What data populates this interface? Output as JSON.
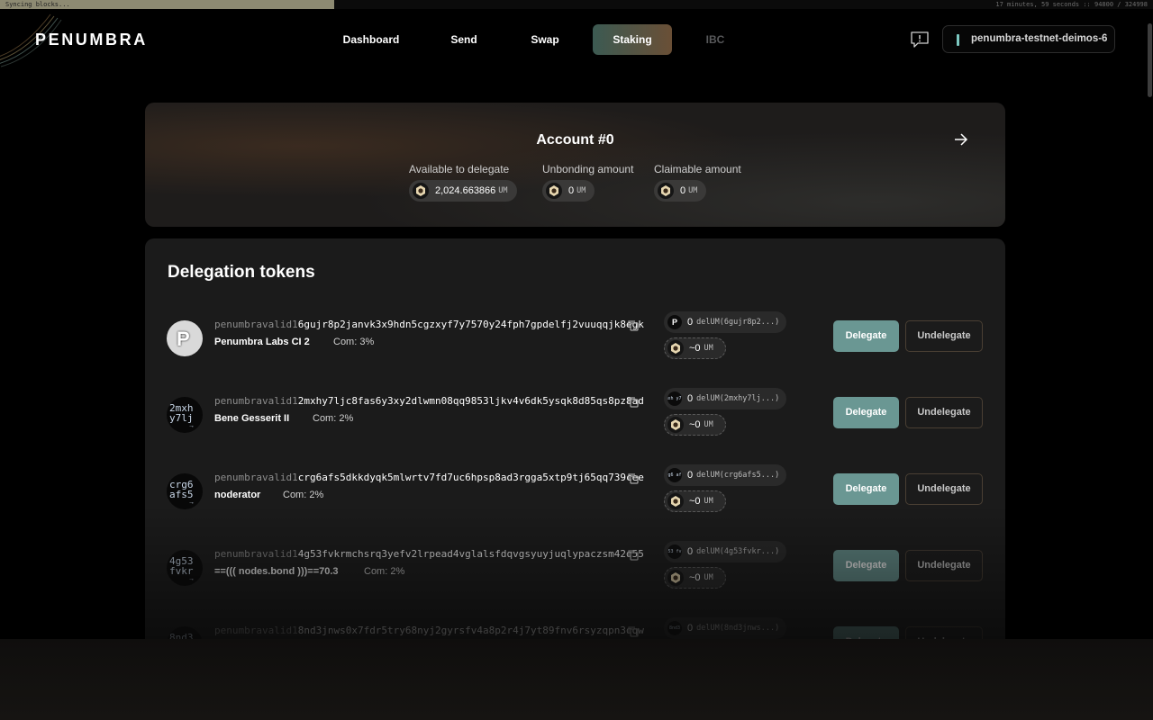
{
  "sync": {
    "status": "Syncing blocks...",
    "time_remaining": "17 minutes, 59 seconds",
    "block_count": "94800 / 324998",
    "progress": 0.29
  },
  "header": {
    "logo": "PENUMBRA",
    "nav": [
      {
        "label": "Dashboard",
        "state": "normal"
      },
      {
        "label": "Send",
        "state": "normal"
      },
      {
        "label": "Swap",
        "state": "normal"
      },
      {
        "label": "Staking",
        "state": "active"
      },
      {
        "label": "IBC",
        "state": "disabled"
      }
    ],
    "feedback_icon": "feedback-icon",
    "chain_id": "penumbra-testnet-deimos-6"
  },
  "account": {
    "title": "Account #0",
    "available": {
      "label": "Available to delegate",
      "amount": "2,024.663866",
      "symbol": "UM"
    },
    "unbonding": {
      "label": "Unbonding amount",
      "amount": "0",
      "symbol": "UM"
    },
    "claimable": {
      "label": "Claimable amount",
      "amount": "0",
      "symbol": "UM"
    }
  },
  "delegation": {
    "title": "Delegation tokens",
    "delegate_label": "Delegate",
    "undelegate_label": "Undelegate",
    "validators": [
      {
        "prefix": "penumbravalid1",
        "id": "6gujr8p2janvk3x9hdn5cgzxyf7y7570y24fph7gpdelfj2vuuqqjk8egk",
        "name": "Penumbra Labs CI 2",
        "commission": "Com: 3%",
        "avatar": "P",
        "delegation_amount": "0",
        "delegation_token": "delUM(6gujr8p2...)",
        "unbonding_amount": "~0",
        "unbonding_token": "UM"
      },
      {
        "prefix": "penumbravalid1",
        "id": "2mxhy7ljc8fas6y3xy2dlwmn08qq9853ljkv4v6dk5ysqk8d85qs8pz8ad",
        "name": "Bene Gesserit II",
        "commission": "Com: 2%",
        "avatar": "2mxh y7lj",
        "delegation_amount": "0",
        "delegation_token": "delUM(2mxhy7lj...)",
        "unbonding_amount": "~0",
        "unbonding_token": "UM"
      },
      {
        "prefix": "penumbravalid1",
        "id": "crg6afs5dkkdyqk5mlwrtv7fd7uc6hpsp8ad3rgga5xtp9tj65qq739cee",
        "name": "noderator",
        "commission": "Com: 2%",
        "avatar": "crg6 afs5",
        "delegation_amount": "0",
        "delegation_token": "delUM(crg6afs5...)",
        "unbonding_amount": "~0",
        "unbonding_token": "UM"
      },
      {
        "prefix": "penumbravalid1",
        "id": "4g53fvkrmchsrq3yefv2lrpead4vglalsfdqvgsyuyjuqlypaczsm42q55",
        "name": "==((( nodes.bond )))==70.3",
        "commission": "Com: 2%",
        "avatar": "4g53 fvkr",
        "delegation_amount": "0",
        "delegation_token": "delUM(4g53fvkr...)",
        "unbonding_amount": "~0",
        "unbonding_token": "UM"
      },
      {
        "prefix": "penumbravalid1",
        "id": "8nd3jnws0x7fdr5try68nyj2gyrsfv4a8p2r4j7yt89fnv6rsyzqpn3qqw",
        "name": "",
        "commission": "",
        "avatar": "8nd3",
        "delegation_amount": "0",
        "delegation_token": "delUM(8nd3jnws...)",
        "unbonding_amount": "",
        "unbonding_token": ""
      }
    ]
  }
}
